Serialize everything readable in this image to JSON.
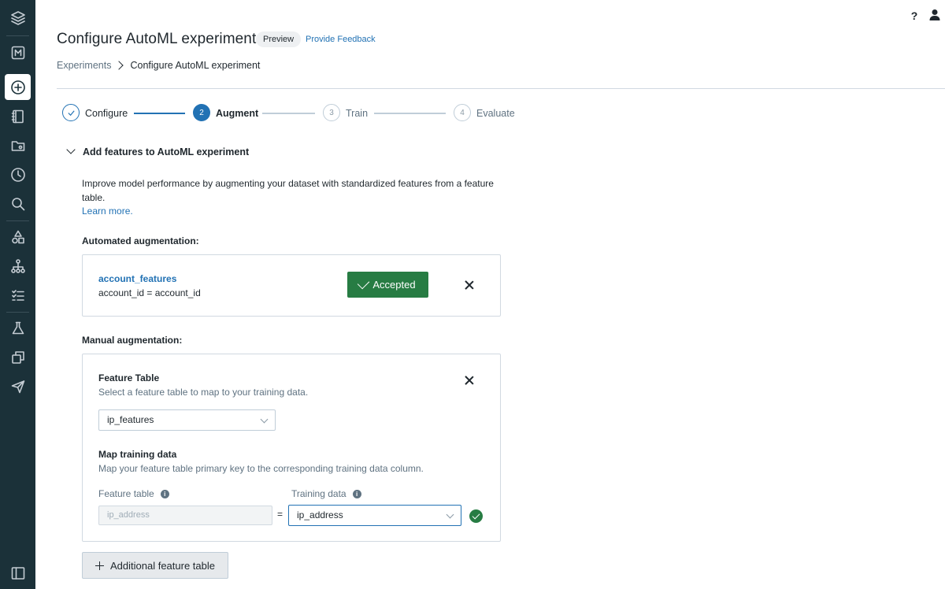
{
  "header": {
    "title": "Configure AutoML experiment",
    "badge": "Preview",
    "feedback_link": "Provide Feedback",
    "help_icon": "?"
  },
  "breadcrumb": {
    "parent": "Experiments",
    "current": "Configure AutoML experiment"
  },
  "stepper": {
    "steps": [
      {
        "number": "1",
        "label": "Configure",
        "state": "complete"
      },
      {
        "number": "2",
        "label": "Augment",
        "state": "active"
      },
      {
        "number": "3",
        "label": "Train",
        "state": "pending"
      },
      {
        "number": "4",
        "label": "Evaluate",
        "state": "pending"
      }
    ]
  },
  "section": {
    "title": "Add features to AutoML experiment",
    "description": "Improve model performance by augmenting your dataset with standardized features from a feature table.",
    "learn_more": "Learn more."
  },
  "automated": {
    "heading": "Automated augmentation:",
    "feature_name": "account_features",
    "feature_key": "account_id = account_id",
    "accepted_label": "Accepted"
  },
  "manual": {
    "heading": "Manual augmentation:",
    "feature_table_title": "Feature Table",
    "feature_table_desc": "Select a feature table to map to your training data.",
    "feature_table_value": "ip_features",
    "map_title": "Map training data",
    "map_desc": "Map your feature table primary key to the corresponding training data column.",
    "feature_table_label": "Feature table",
    "training_data_label": "Training data",
    "feature_key_value": "ip_address",
    "equals": "=",
    "training_data_value": "ip_address"
  },
  "add_button": "Additional feature table",
  "colors": {
    "sidebar": "#1b3139",
    "accent": "#2272b4",
    "success": "#277c43"
  },
  "sidebar_icons": [
    "layers-icon",
    "m-badge-icon",
    "plus-circle-icon",
    "notebook-icon",
    "folder-icon",
    "clock-icon",
    "search-icon",
    "shapes-icon",
    "workflow-icon",
    "checklist-icon",
    "flask-icon",
    "copy-icon",
    "send-icon",
    "panel-icon"
  ]
}
